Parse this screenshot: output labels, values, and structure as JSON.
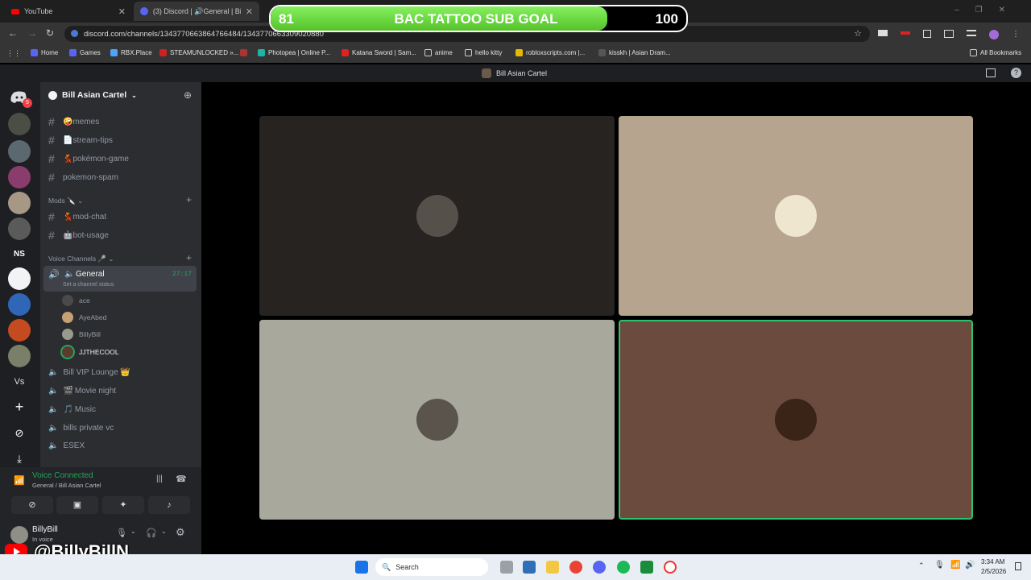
{
  "browser": {
    "tabs": [
      {
        "label": "YouTube"
      },
      {
        "label": "(3) Discord | 🔊General | Bil"
      }
    ],
    "url": "discord.com/channels/1343770663864766484/1343770663309020880",
    "bookmarks": [
      "Home",
      "Games",
      "RBX.Place",
      "STEAMUNLOCKED »...",
      "Photopea | Online P...",
      "Katana Sword | Sam...",
      "anime",
      "hello kitty",
      "robloxscripts.com |...",
      "kisskh | Asian Dram..."
    ],
    "all_bookmarks": "All Bookmarks"
  },
  "discord": {
    "window_title": "Bill Asian Cartel",
    "server_name": "Bill Asian Cartel",
    "server_badge": "5",
    "channels_top": [
      {
        "label": "memes",
        "emoji": "🤪"
      },
      {
        "label": "stream-tips",
        "emoji": "📄"
      },
      {
        "label": "pokémon-game",
        "emoji": "💃"
      },
      {
        "label": "pokemon-spam",
        "emoji": ""
      }
    ],
    "mods_category": "Mods 🔪",
    "mods_channels": [
      {
        "label": "mod-chat",
        "emoji": "💃"
      },
      {
        "label": "bot-usage",
        "emoji": "🤖"
      }
    ],
    "voice_category": "Voice Channels 🎤",
    "general": {
      "label": "General",
      "timer": "27:17",
      "status": "Set a channel status"
    },
    "members": [
      {
        "name": "ace"
      },
      {
        "name": "AyeAbed"
      },
      {
        "name": "BillyBill"
      },
      {
        "name": "JJTHECOOL"
      }
    ],
    "voice_channels": [
      "Bill VIP Lounge 👑",
      "Movie night",
      "Music",
      "bills private vc",
      "ESEX"
    ],
    "voice_emojis": [
      "👑",
      "🎬",
      "🎵",
      "",
      ""
    ],
    "voice_status": {
      "title": "Voice Connected",
      "sub": "General / Bill Asian Cartel"
    },
    "user": {
      "name": "BillyBill",
      "status": "In voice"
    },
    "tile_colors": [
      "#262320",
      "#b6a48f",
      "#a8a89c",
      "#6b4b3e"
    ]
  },
  "overlay": {
    "goal_current": "81",
    "goal_target": "100",
    "goal_label": "BAC TATTOO SUB GOAL",
    "goal_fraction": 0.81,
    "yt_handle": "@BillyBillN"
  },
  "taskbar": {
    "search": "Search",
    "time": "3:34 AM",
    "date": "2/5/2026"
  }
}
